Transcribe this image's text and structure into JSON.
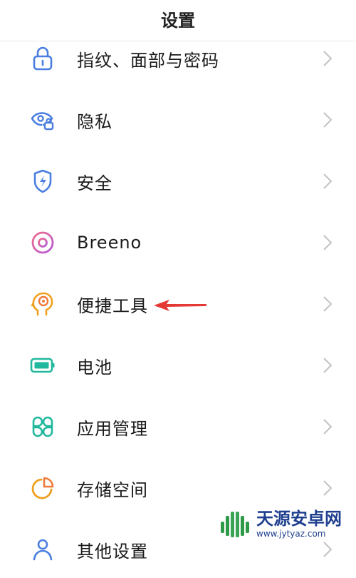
{
  "header": {
    "title": "设置"
  },
  "settings_items": [
    {
      "label": "指纹、面部与密码",
      "icon": "lock-icon",
      "color": "#4a7ee0"
    },
    {
      "label": "隐私",
      "icon": "privacy-eye-lock-icon",
      "color": "#4a7ee0"
    },
    {
      "label": "安全",
      "icon": "shield-bolt-icon",
      "color": "#4a7ee0"
    },
    {
      "label": "Breeno",
      "icon": "breeno-ring-icon",
      "color": "#e0559d"
    },
    {
      "label": "便捷工具",
      "icon": "head-target-icon",
      "color": "#f0a020"
    },
    {
      "label": "电池",
      "icon": "battery-icon",
      "color": "#22b89e"
    },
    {
      "label": "应用管理",
      "icon": "app-grid-icon",
      "color": "#22b89e"
    },
    {
      "label": "存储空间",
      "icon": "pie-storage-icon",
      "color": "#f0a020"
    },
    {
      "label": "其他设置",
      "icon": "person-settings-icon",
      "color": "#4a7ee0"
    }
  ],
  "annotation": {
    "arrow_color": "#e53935"
  },
  "watermark": {
    "title": "天源安卓网",
    "url": "www.jytyaz.com"
  }
}
